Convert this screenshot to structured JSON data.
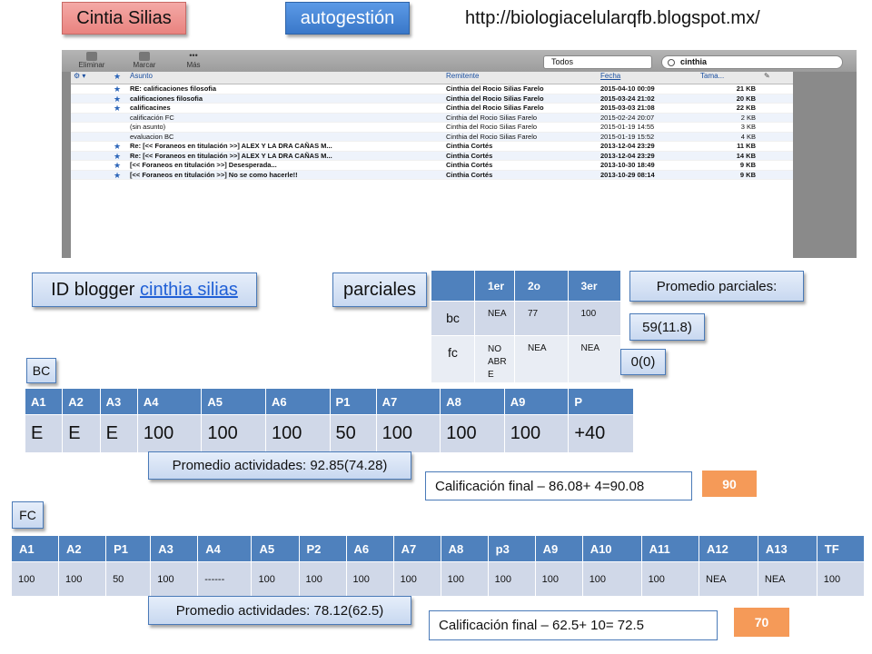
{
  "header": {
    "name_label": "Cintia Silias",
    "autogestion_label": "autogestión",
    "url": "http://biologiacelularqfb.blogspot.mx/"
  },
  "mail": {
    "toolbar": [
      "Eliminar",
      "Marcar",
      "Más"
    ],
    "folder_select": "Todos",
    "search_value": "cinthia",
    "columns": [
      "Asunto",
      "Remitente",
      "Fecha",
      "Tama..."
    ],
    "rows": [
      {
        "star": "★",
        "subject": "RE: calificaciones filosofia",
        "from": "Cinthia del Rocio Silias Farelo",
        "date": "2015-04-10 00:09",
        "size": "21 KB",
        "bold": true
      },
      {
        "star": "★",
        "subject": "calificaciones filosofia",
        "from": "Cinthia del Rocio Silias Farelo",
        "date": "2015-03-24 21:02",
        "size": "20 KB",
        "bold": true
      },
      {
        "star": "★",
        "subject": "calificacines",
        "from": "Cinthia del Rocio Silias Farelo",
        "date": "2015-03-03 21:08",
        "size": "22 KB",
        "bold": true
      },
      {
        "star": "",
        "subject": "calificación FC",
        "from": "Cinthia del Rocio Silias Farelo",
        "date": "2015-02-24 20:07",
        "size": "2 KB",
        "bold": false
      },
      {
        "star": "",
        "subject": "(sin asunto)",
        "from": "Cinthia del Rocio Silias Farelo",
        "date": "2015-01-19 14:55",
        "size": "3 KB",
        "bold": false
      },
      {
        "star": "",
        "subject": "evaluacion BC",
        "from": "Cinthia del Rocio Silias Farelo",
        "date": "2015-01-19 15:52",
        "size": "4 KB",
        "bold": false
      },
      {
        "star": "★",
        "subject": "Re: [<< Foraneos en titulación >>] ALEX Y LA DRA CAÑAS M...",
        "from": "Cinthia Cortés",
        "date": "2013-12-04 23:29",
        "size": "11 KB",
        "bold": true
      },
      {
        "star": "★",
        "subject": "Re: [<< Foraneos en titulación >>] ALEX Y LA DRA CAÑAS M...",
        "from": "Cinthia Cortés",
        "date": "2013-12-04 23:29",
        "size": "14 KB",
        "bold": true
      },
      {
        "star": "★",
        "subject": "[<< Foraneos en titulación >>] Desesperada...",
        "from": "Cinthia Cortés",
        "date": "2013-10-30 18:49",
        "size": "9 KB",
        "bold": true
      },
      {
        "star": "★",
        "subject": "[<< Foraneos en titulación >>] No se como hacerle!!",
        "from": "Cinthia Cortés",
        "date": "2013-10-29 08:14",
        "size": "9 KB",
        "bold": true
      }
    ]
  },
  "blogger": {
    "prefix": "ID blogger ",
    "link": "cinthia silias"
  },
  "parciales": {
    "label": "parciales",
    "headers": [
      "",
      "1er",
      "2o",
      "3er"
    ],
    "rows": [
      [
        "bc",
        "NEA",
        "77",
        "100"
      ],
      [
        "fc",
        "NO ABR E",
        "NEA",
        "NEA"
      ]
    ],
    "promedio_label": "Promedio parciales:",
    "promedio_bc": "59(11.8)",
    "promedio_fc": "0(0)"
  },
  "bc": {
    "label": "BC",
    "headers": [
      "A1",
      "A2",
      "A3",
      "A4",
      "A5",
      "A6",
      "P1",
      "A7",
      "A8",
      "A9",
      "P"
    ],
    "values": [
      "E",
      "E",
      "E",
      "100",
      "100",
      "100",
      "50",
      "100",
      "100",
      "100",
      "+40"
    ],
    "promedio": "Promedio actividades: 92.85(74.28)",
    "final": "Calificación final – 86.08+ 4=90.08",
    "grade": "90"
  },
  "fc": {
    "label": "FC",
    "headers": [
      "A1",
      "A2",
      "P1",
      "A3",
      "A4",
      "A5",
      "P2",
      "A6",
      "A7",
      "A8",
      "p3",
      "A9",
      "A10",
      "A11",
      "A12",
      "A13",
      "TF"
    ],
    "values": [
      "100",
      "100",
      "50",
      "100",
      "------",
      "100",
      "100",
      "100",
      "100",
      "100",
      "100",
      "100",
      "100",
      "100",
      "NEA",
      "NEA",
      "100"
    ],
    "promedio": "Promedio actividades: 78.12(62.5)",
    "final": "Calificación final – 62.5+ 10= 72.5",
    "grade": "70"
  },
  "colors": {
    "table_header": "#4f81bd",
    "table_cell": "#d0d8e8",
    "grade_badge": "#f59a58",
    "callout_red": "#e9837f",
    "callout_blue": "#3a78c9"
  }
}
